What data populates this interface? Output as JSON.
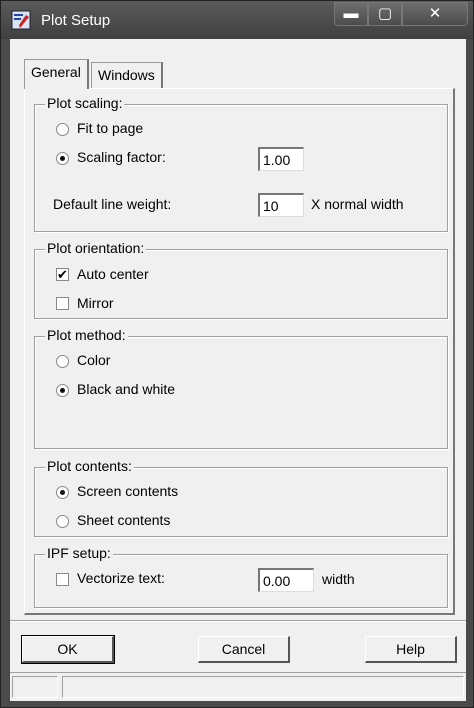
{
  "window": {
    "title": "Plot Setup",
    "icon": "plot-setup-app-icon"
  },
  "titlebar_buttons": {
    "minimize": "▬",
    "maximize": "▢",
    "close": "✕"
  },
  "tabs": [
    {
      "label": "General",
      "active": true
    },
    {
      "label": "Windows",
      "active": false
    }
  ],
  "plot_scaling": {
    "label": "Plot scaling:",
    "fit_to_page": {
      "label": "Fit to page",
      "selected": false
    },
    "scaling_factor": {
      "label": "Scaling factor:",
      "selected": true,
      "value": "1.00"
    },
    "line_weight": {
      "label": "Default line weight:",
      "value": "10",
      "unit": "X normal width"
    }
  },
  "plot_orientation": {
    "label": "Plot orientation:",
    "auto_center": {
      "label": "Auto center",
      "checked": true
    },
    "mirror": {
      "label": "Mirror",
      "checked": false
    }
  },
  "plot_method": {
    "label": "Plot method:",
    "color": {
      "label": "Color",
      "selected": false
    },
    "black_white": {
      "label": "Black and white",
      "selected": true
    }
  },
  "plot_contents": {
    "label": "Plot contents:",
    "screen": {
      "label": "Screen contents",
      "selected": true
    },
    "sheet": {
      "label": "Sheet contents",
      "selected": false
    }
  },
  "ipf_setup": {
    "label": "IPF setup:",
    "vectorize": {
      "label": "Vectorize text:",
      "checked": false,
      "value": "0.00",
      "unit": "width"
    }
  },
  "buttons": {
    "ok": "OK",
    "cancel": "Cancel",
    "help": "Help"
  },
  "check_glyph": "✔"
}
